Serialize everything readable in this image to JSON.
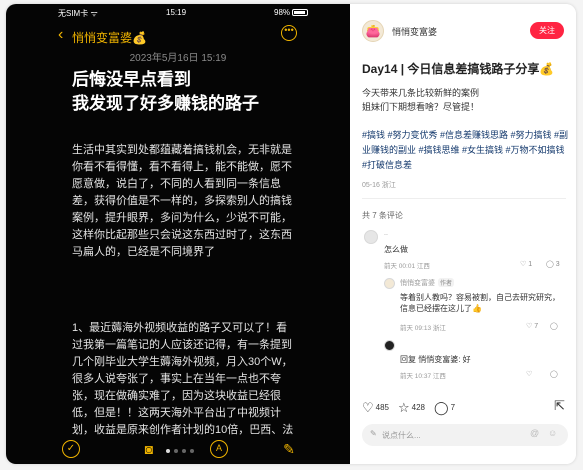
{
  "phone": {
    "status": {
      "carrier": "无SIM卡 ᯤ",
      "time": "15:19",
      "battery": "98%"
    },
    "nav": {
      "back": "‹",
      "title": "悄悄变富婆💰",
      "more": "•••"
    },
    "note": {
      "date": "2023年5月16日 15:19",
      "title": "后悔没早点看到\n我发现了好多赚钱的路子",
      "para1": "生活中其实到处都蕴藏着搞钱机会，无非就是你看不看得懂，看不看得上，能不能做，愿不愿意做，说白了，不同的人看到同一条信息差，获得价值是不一样的，多探索别人的搞钱案例，提升眼界，多问为什么，少说不可能，这样你比起那些只会说这东西过时了，这东西马扁人的，已经是不同境界了",
      "para2": "1、最近薅海外视频收益的路子又可以了！看过我第一篇笔记的人应该还记得，有一条提到几个刚毕业大学生薅海外视频，月入30个W，很多人说夸张了，事实上在当年一点也不夸张，现在做确实难了，因为这块收益已经很低，但是！！这两天海外平台出了中视频计划，收益是原来创作者计划的10倍，巴西、法国、漂亮国等地区已经开始这项计划了，感兴趣可以自"
    },
    "bottom": {
      "check": "✓",
      "camera": "◙",
      "nav": "A",
      "edit": "✎"
    }
  },
  "panel": {
    "author": {
      "avatar": "👛",
      "name": "悄悄变富婆",
      "follow": "关注"
    },
    "title": "Day14 | 今日信息差搞钱路子分享💰",
    "body": "今天带来几条比较新鲜的案例\n姐妹们下期想看啥？尽管提！",
    "tags": "#搞钱 #努力变优秀 #信息差赚钱思路 #努力搞钱 #副业赚钱的副业 #搞钱思维 #女生搞钱 #万物不如搞钱 #打破信息差",
    "meta": "05-16 浙江",
    "comments_count": "共 7 条评论",
    "comments": [
      {
        "name": "..",
        "text": "怎么做",
        "meta": "前天 00:01 江西",
        "likes": "♡ 1",
        "replies": "◯ 3"
      },
      {
        "name": "悄悄变富婆",
        "tag": "作者",
        "text": "等着别人教吗？容易被割，自己去研究研究，信息已经摆在这儿了👍",
        "meta": "前天 09:13 浙江",
        "likes": "♡ 7",
        "replies": "◯"
      },
      {
        "name": "",
        "text": "回复 悄悄变富婆: 好",
        "meta": "前天 10:37 江西",
        "likes": "♡",
        "replies": "◯"
      }
    ],
    "actions": {
      "likes": "485",
      "stars": "428",
      "comments": "7",
      "share": "⇱"
    },
    "input_placeholder": "说点什么...",
    "input_at": "@",
    "input_emoji": "☺"
  }
}
